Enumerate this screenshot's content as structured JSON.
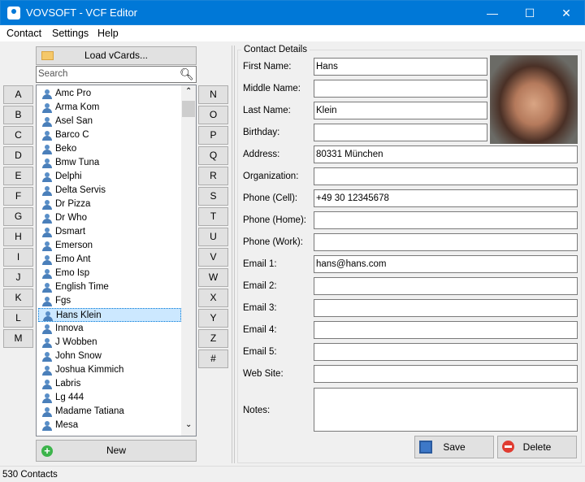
{
  "window": {
    "title": "VOVSOFT - VCF Editor",
    "controls": [
      "—",
      "☐",
      "✕"
    ]
  },
  "menu": [
    "Contact",
    "Settings",
    "Help"
  ],
  "left": {
    "load_label": "Load vCards...",
    "search_placeholder": "Search",
    "letters_left": [
      "A",
      "B",
      "C",
      "D",
      "E",
      "F",
      "G",
      "H",
      "I",
      "J",
      "K",
      "L",
      "M"
    ],
    "letters_right": [
      "N",
      "O",
      "P",
      "Q",
      "R",
      "S",
      "T",
      "U",
      "V",
      "W",
      "X",
      "Y",
      "Z",
      "#"
    ],
    "contacts": [
      "Amc Pro",
      "Arma Kom",
      "Asel San",
      "Barco C",
      "Beko",
      "Bmw Tuna",
      "Delphi",
      "Delta Servis",
      "Dr Pizza",
      "Dr Who",
      "Dsmart",
      "Emerson",
      "Emo Ant",
      "Emo Isp",
      "English Time",
      "Fgs",
      "Hans Klein",
      "Innova",
      "J Wobben",
      "John Snow",
      "Joshua Kimmich",
      "Labris",
      "Lg 444",
      "Madame Tatiana",
      "Mesa"
    ],
    "selected": "Hans Klein",
    "new_label": "New"
  },
  "details": {
    "group_title": "Contact Details",
    "fields": [
      {
        "label": "First Name:",
        "value": "Hans"
      },
      {
        "label": "Middle Name:",
        "value": ""
      },
      {
        "label": "Last Name:",
        "value": "Klein"
      },
      {
        "label": "Birthday:",
        "value": ""
      },
      {
        "label": "Address:",
        "value": "80331 München"
      },
      {
        "label": "Organization:",
        "value": ""
      },
      {
        "label": "Phone (Cell):",
        "value": "+49 30 12345678"
      },
      {
        "label": "Phone (Home):",
        "value": ""
      },
      {
        "label": "Phone (Work):",
        "value": ""
      },
      {
        "label": "Email 1:",
        "value": "hans@hans.com"
      },
      {
        "label": "Email 2:",
        "value": ""
      },
      {
        "label": "Email 3:",
        "value": ""
      },
      {
        "label": "Email 4:",
        "value": ""
      },
      {
        "label": "Email 5:",
        "value": ""
      },
      {
        "label": "Web Site:",
        "value": ""
      }
    ],
    "notes_label": "Notes:",
    "notes_value": "",
    "save_label": "Save",
    "delete_label": "Delete"
  },
  "status": "530 Contacts"
}
